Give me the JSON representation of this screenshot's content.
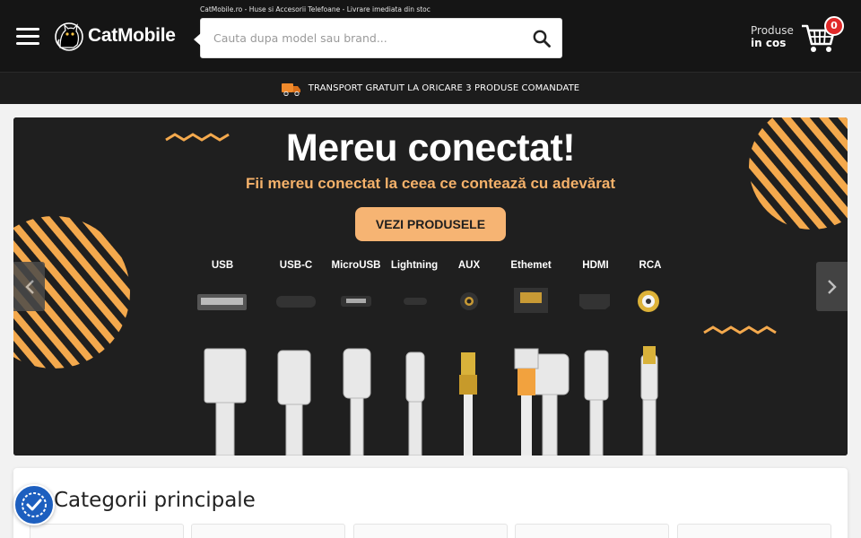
{
  "header": {
    "tagline": "CatMobile.ro - Huse si Accesorii Telefoane - Livrare imediata din stoc",
    "logo_text": "CatMobile",
    "search_placeholder": "Cauta dupa model sau brand...",
    "cart_label_line1": "Produse",
    "cart_label_line2": "in cos",
    "cart_count": "0"
  },
  "promo": {
    "text": "TRANSPORT GRATUIT LA ORICARE 3 PRODUSE COMANDATE"
  },
  "hero": {
    "title": "Mereu conectat!",
    "subtitle": "Fii mereu conectat la ceea ce contează cu adevărat",
    "cta": "VEZI PRODUSELE",
    "ports": [
      "USB",
      "USB-C",
      "MicroUSB",
      "Lightning",
      "AUX",
      "Ethemet",
      "HDMI",
      "RCA"
    ]
  },
  "categories": {
    "title": "Categorii principale"
  },
  "colors": {
    "header_bg": "#151515",
    "accent_orange": "#f6b473",
    "badge_red": "#e02929",
    "a11y_blue": "#1d5fbf"
  }
}
